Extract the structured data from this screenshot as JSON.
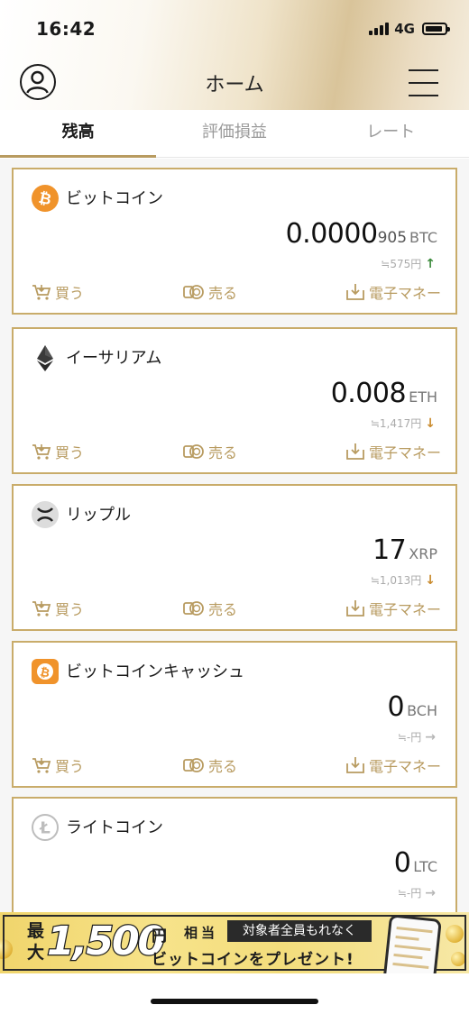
{
  "status_bar": {
    "time": "16:42",
    "network": "4G"
  },
  "nav": {
    "title": "ホーム"
  },
  "tabs": [
    {
      "label": "残高",
      "active": true
    },
    {
      "label": "評価損益",
      "active": false
    },
    {
      "label": "レート",
      "active": false
    }
  ],
  "actions": {
    "buy": "買う",
    "sell": "売る",
    "emoney": "電子マネー"
  },
  "cards": [
    {
      "name": "ビットコイン",
      "amount_main": "0.0000",
      "amount_sub": "905",
      "unit": "BTC",
      "jpy": "≒575円",
      "trend": "up",
      "icon": "bitcoin-icon",
      "color": "#f0932b"
    },
    {
      "name": "イーサリアム",
      "amount_main": "0.008",
      "amount_sub": "",
      "unit": "ETH",
      "jpy": "≒1,417円",
      "trend": "down",
      "icon": "ethereum-icon",
      "color": "#333333"
    },
    {
      "name": "リップル",
      "amount_main": "17",
      "amount_sub": "",
      "unit": "XRP",
      "jpy": "≒1,013円",
      "trend": "down",
      "icon": "ripple-icon",
      "color": "#3a3a3a"
    },
    {
      "name": "ビットコインキャッシュ",
      "amount_main": "0",
      "amount_sub": "",
      "unit": "BCH",
      "jpy": "≒-円",
      "trend": "flat",
      "icon": "bitcoin-cash-icon",
      "color": "#f0932b"
    },
    {
      "name": "ライトコイン",
      "amount_main": "0",
      "amount_sub": "",
      "unit": "LTC",
      "jpy": "≒-円",
      "trend": "flat",
      "icon": "litecoin-icon",
      "color": "#bdbdbd"
    }
  ],
  "banner": {
    "max": "最大",
    "amount": "1,500",
    "yen": "円",
    "equiv": "相当",
    "tag": "対象者全員もれなく",
    "line2": "ビットコインをプレゼント!"
  },
  "colors": {
    "gold": "#c9ac6a",
    "gold_text": "#b89b60",
    "up": "#3b8a3b",
    "down": "#c98a2c"
  }
}
